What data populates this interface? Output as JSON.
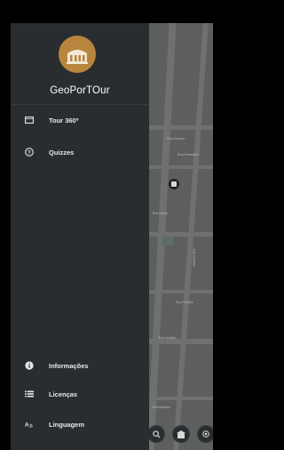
{
  "app": {
    "title": "GeoPorTOur"
  },
  "menu": {
    "items": [
      {
        "label": "Tour 360º",
        "icon": "panorama-icon"
      },
      {
        "label": "Quizzes",
        "icon": "help-circle-icon"
      }
    ],
    "bottom_items": [
      {
        "label": "Informações",
        "icon": "info-icon"
      },
      {
        "label": "Licenças",
        "icon": "list-icon"
      },
      {
        "label": "Linguagem",
        "icon": "translate-icon"
      }
    ]
  },
  "map": {
    "street_labels": [
      "Rua Floresta",
      "Rua Fernandes",
      "Rua Santa",
      "Rua Godinho",
      "Rua Franklin",
      "Rua Cândido",
      "Rua Mariano"
    ]
  },
  "colors": {
    "drawer_bg": "#2a2d30",
    "logo": "#b7853d",
    "map_bg": "#5d5f5f"
  }
}
